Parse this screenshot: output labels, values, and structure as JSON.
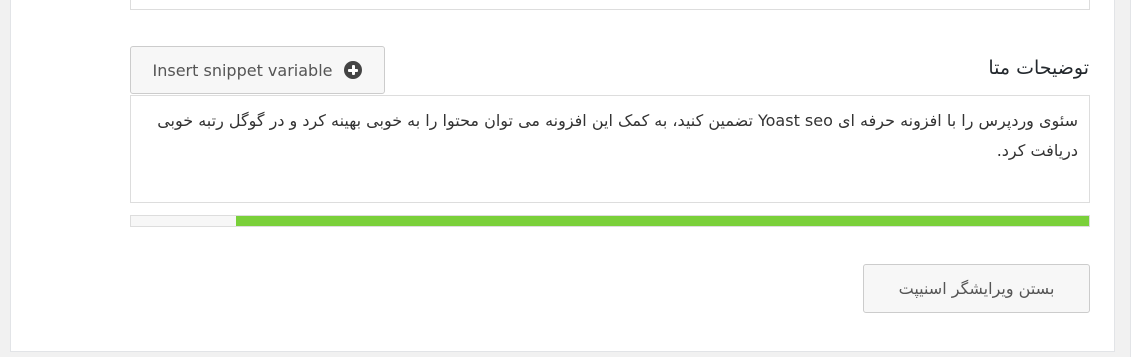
{
  "snippet_editor": {
    "meta_description_label": "توضیحات متا",
    "insert_variable_label": "Insert snippet variable",
    "insert_variable_icon": "plus-circle-icon",
    "meta_description_value": "سئوی وردپرس را با افزونه حرفه ای Yoast seo تضمین کنید، به کمک این افزونه می توان محتوا را به خوبی بهینه کرد و در گوگل رتبه خوبی دریافت کرد.",
    "progress_fraction": 0.89,
    "progress_color": "#7ad03a",
    "close_editor_label": "بستن ویرایشگر اسنیپت"
  }
}
